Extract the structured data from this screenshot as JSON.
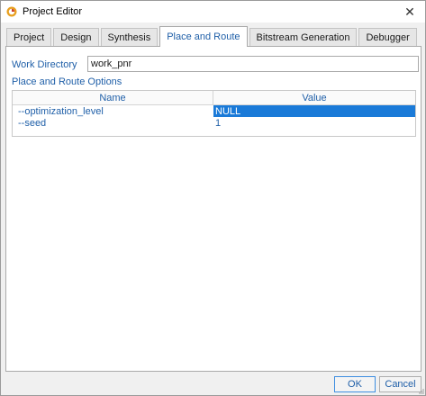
{
  "window": {
    "title": "Project Editor",
    "close_glyph": "✕",
    "app_icon": "app-logo-icon",
    "close_icon": "close-icon"
  },
  "tabs": [
    {
      "label": "Project",
      "active": false
    },
    {
      "label": "Design",
      "active": false
    },
    {
      "label": "Synthesis",
      "active": false
    },
    {
      "label": "Place and Route",
      "active": true
    },
    {
      "label": "Bitstream Generation",
      "active": false
    },
    {
      "label": "Debugger",
      "active": false
    }
  ],
  "panel": {
    "work_directory_label": "Work Directory",
    "work_directory_value": "work_pnr",
    "options_label": "Place and Route Options",
    "table": {
      "columns": [
        "Name",
        "Value"
      ],
      "rows": [
        {
          "name": "--optimization_level",
          "value": "NULL",
          "selected": true
        },
        {
          "name": "--seed",
          "value": "1",
          "selected": false
        }
      ]
    }
  },
  "buttons": {
    "ok": "OK",
    "cancel": "Cancel"
  },
  "colors": {
    "accent_text": "#1f5fa8",
    "selection": "#1a7ad8",
    "background": "#f0f0f0"
  }
}
